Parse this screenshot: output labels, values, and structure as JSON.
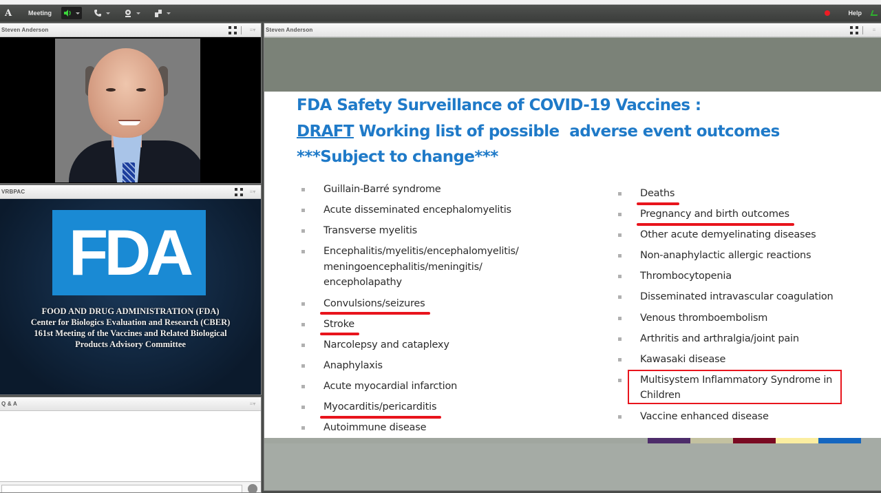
{
  "app": {
    "menu_label": "Meeting",
    "help_label": "Help",
    "toolbar": [
      {
        "name": "speaker",
        "icon": "speaker-icon",
        "active": true
      },
      {
        "name": "phone",
        "icon": "phone-icon",
        "active": false
      },
      {
        "name": "webcam",
        "icon": "webcam-icon",
        "active": false
      },
      {
        "name": "attendee-status",
        "icon": "hand-raise-icon",
        "active": false
      }
    ],
    "recording_color": "#ee1c24"
  },
  "pods": {
    "video": {
      "title": "Steven Anderson"
    },
    "logo": {
      "title": "VRBPAC",
      "logo_text": "FDA",
      "lines": [
        "FOOD AND DRUG ADMINISTRATION (FDA)",
        "Center for Biologics Evaluation and Research (CBER)",
        "161st Meeting of the Vaccines and Related Biological",
        "Products Advisory Committee"
      ]
    },
    "qa": {
      "title": "Q & A",
      "input_placeholder": ""
    },
    "share": {
      "title": "Steven Anderson"
    }
  },
  "slide": {
    "title_line1": "FDA Safety Surveillance of COVID-19 Vaccines :",
    "title_line2_underlined": "DRAFT",
    "title_line2_rest": " Working list of possible  adverse event outcomes",
    "title_line3": "***Subject to change***",
    "accent_color": "#1f7ac8",
    "highlight_color": "#e8141c",
    "left_items": [
      {
        "text": "Guillain-Barré syndrome",
        "mark": "none"
      },
      {
        "text": "Acute disseminated encephalomyelitis",
        "mark": "none"
      },
      {
        "text": "Transverse myelitis",
        "mark": "none"
      },
      {
        "text": "Encephalitis/myelitis/encephalomyelitis/ meningoencephalitis/meningitis/ encepholapathy",
        "mark": "none"
      },
      {
        "text": "Convulsions/seizures",
        "mark": "underline"
      },
      {
        "text": "Stroke",
        "mark": "underline"
      },
      {
        "text": "Narcolepsy and cataplexy",
        "mark": "none"
      },
      {
        "text": "Anaphylaxis",
        "mark": "none"
      },
      {
        "text": "Acute myocardial infarction",
        "mark": "none"
      },
      {
        "text": "Myocarditis/pericarditis",
        "mark": "underline"
      },
      {
        "text": "Autoimmune disease",
        "mark": "none"
      }
    ],
    "right_items": [
      {
        "text": "Deaths",
        "mark": "underline"
      },
      {
        "text": "Pregnancy and birth outcomes",
        "mark": "underline"
      },
      {
        "text": "Other acute demyelinating diseases",
        "mark": "none"
      },
      {
        "text": "Non-anaphylactic allergic reactions",
        "mark": "none"
      },
      {
        "text": "Thrombocytopenia",
        "mark": "none"
      },
      {
        "text": "Disseminated intravascular coagulation",
        "mark": "none"
      },
      {
        "text": "Venous thromboembolism",
        "mark": "none"
      },
      {
        "text": "Arthritis and arthralgia/joint pain",
        "mark": "none"
      },
      {
        "text": "Kawasaki disease",
        "mark": "none"
      },
      {
        "text": "Multisystem Inflammatory Syndrome in Children",
        "mark": "box"
      },
      {
        "text": "Vaccine enhanced disease",
        "mark": "none"
      }
    ],
    "footer_colors": [
      "#a0a69f",
      "#4d2c6a",
      "#c3c1a0",
      "#7a0a22",
      "#fbeea0",
      "#1466c0"
    ]
  }
}
